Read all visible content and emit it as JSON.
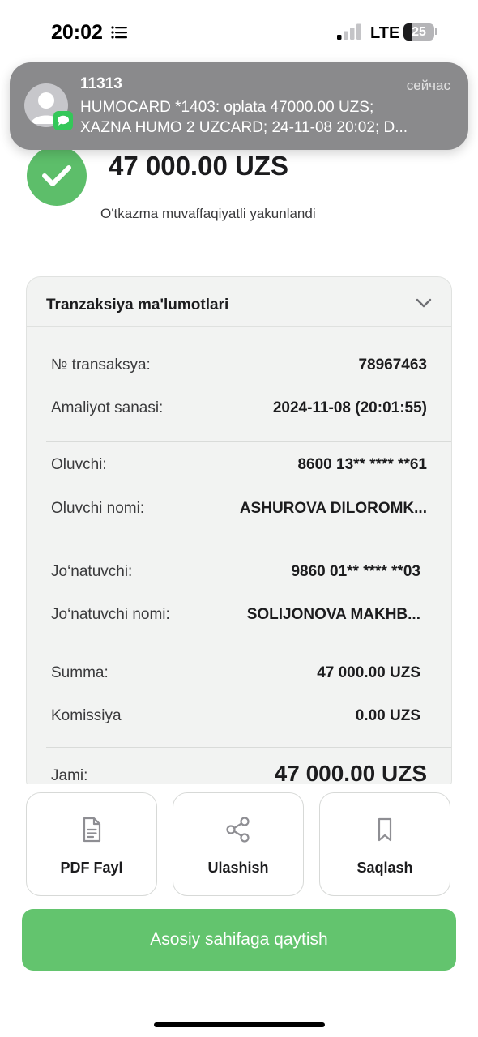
{
  "status_bar": {
    "time": "20:02",
    "network": "LTE",
    "battery_level": "25",
    "battery_fraction": 0.25,
    "signal_bars_active": 1,
    "signal_bars_total": 4
  },
  "notification": {
    "sender": "11313",
    "time": "сейчас",
    "line1": "HUMOCARD *1403: oplata 47000.00 UZS;",
    "line2": "XAZNA HUMO 2 UZCARD; 24-11-08 20:02;  D...",
    "app_icon": "messages-icon"
  },
  "success": {
    "amount": "47 000.00 UZS",
    "message": "O'tkazma muvaffaqiyatli yakunlandi",
    "icon": "checkmark-icon"
  },
  "details": {
    "title": "Tranzaksiya ma'lumotlari",
    "rows": [
      {
        "label": "№ transaksya:",
        "value": "78967463"
      },
      {
        "label": "Amaliyot sanasi:",
        "value": "2024-11-08 (20:01:55)"
      },
      {
        "label": "Oluvchi:",
        "value": "8600 13** **** **61"
      },
      {
        "label": "Oluvchi nomi:",
        "value": "ASHUROVA DILOROMK..."
      },
      {
        "label": "Jo‘natuvchi:",
        "value": "9860 01** **** **03"
      },
      {
        "label": "Jo‘natuvchi nomi:",
        "value": "SOLIJONOVA MAKHB..."
      },
      {
        "label": "Summa:",
        "value": "47 000.00 UZS"
      },
      {
        "label": "Komissiya",
        "value": "0.00 UZS"
      },
      {
        "label": "Jami:",
        "value": "47 000.00 UZS"
      }
    ]
  },
  "actions": [
    {
      "label": "PDF Fayl",
      "icon": "document-icon"
    },
    {
      "label": "Ulashish",
      "icon": "share-icon"
    },
    {
      "label": "Saqlash",
      "icon": "bookmark-icon"
    }
  ],
  "primary_button": {
    "label": "Asosiy sahifaga qaytish"
  },
  "colors": {
    "accent_green": "#63c46e",
    "success_green": "#5dbe6a",
    "notification_bg": "#8a8a8c",
    "card_bg": "#f2f3f2"
  }
}
